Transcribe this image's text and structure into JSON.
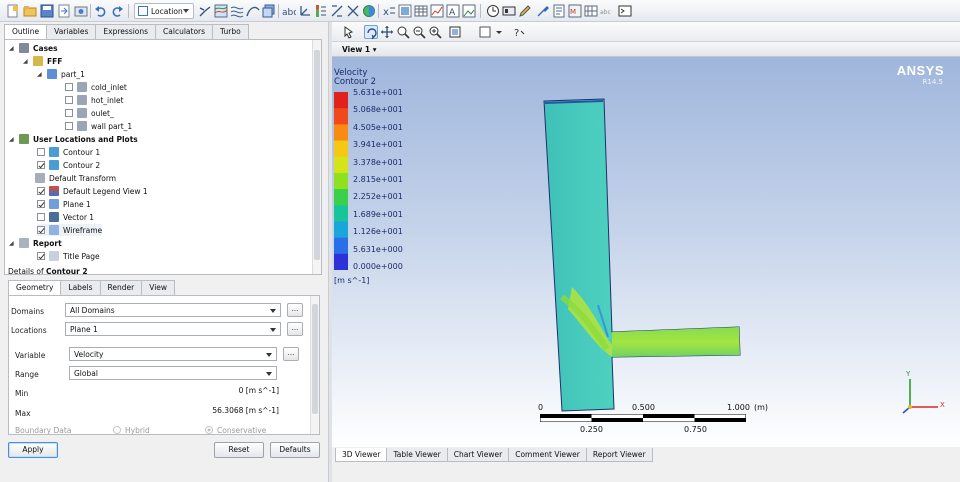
{
  "toolbar": {
    "location_label": "Location"
  },
  "outline": {
    "tabs": [
      "Outline",
      "Variables",
      "Expressions",
      "Calculators",
      "Turbo"
    ],
    "tree": [
      {
        "label": "Cases",
        "bold": true
      },
      {
        "label": "FFF",
        "bold": true
      },
      {
        "label": "part_1"
      },
      {
        "label": "cold_inlet"
      },
      {
        "label": "hot_inlet"
      },
      {
        "label": "oulet_"
      },
      {
        "label": "wall part_1"
      },
      {
        "label": "User Locations and Plots",
        "bold": true
      },
      {
        "label": "Contour 1"
      },
      {
        "label": "Contour 2"
      },
      {
        "label": "Default Transform"
      },
      {
        "label": "Default Legend View 1"
      },
      {
        "label": "Plane 1"
      },
      {
        "label": "Vector 1"
      },
      {
        "label": "Wireframe"
      },
      {
        "label": "Report",
        "bold": true
      },
      {
        "label": "Title Page"
      }
    ]
  },
  "details": {
    "prefix": "Details of",
    "object": "Contour 2",
    "tabs": [
      "Geometry",
      "Labels",
      "Render",
      "View"
    ],
    "domains_label": "Domains",
    "domains_value": "All Domains",
    "locations_label": "Locations",
    "locations_value": "Plane 1",
    "variable_label": "Variable",
    "variable_value": "Velocity",
    "range_label": "Range",
    "range_value": "Global",
    "min_label": "Min",
    "min_value": "0 [m s^-1]",
    "max_label": "Max",
    "max_value": "56.3068 [m s^-1]",
    "boundary_label": "Boundary Data",
    "hybrid_label": "Hybrid",
    "conservative_label": "Conservative",
    "ellipsis": "...",
    "apply": "Apply",
    "reset": "Reset",
    "defaults": "Defaults"
  },
  "viewer": {
    "view_label": "View 1",
    "brand": "ANSYS",
    "version": "R14.5",
    "legend": {
      "variable": "Velocity",
      "plot": "Contour 2",
      "unit": "[m s^-1]",
      "labels": [
        "5.631e+001",
        "5.068e+001",
        "4.505e+001",
        "3.941e+001",
        "3.378e+001",
        "2.815e+001",
        "2.252e+001",
        "1.689e+001",
        "1.126e+001",
        "5.631e+000",
        "0.000e+000"
      ],
      "colors": [
        "#e0221d",
        "#f04a1c",
        "#f98a14",
        "#f6c816",
        "#d5e31a",
        "#8fe01f",
        "#3bd04a",
        "#1ac49a",
        "#1aa6d8",
        "#2a6fe8",
        "#2d32d8"
      ]
    },
    "scale": {
      "labels_top": [
        "0",
        "0.500",
        "1.000",
        "(m)"
      ],
      "labels_bottom": [
        "0.250",
        "0.750"
      ]
    },
    "axis_y": "Y",
    "axis_x": "X",
    "tabs": [
      "3D Viewer",
      "Table Viewer",
      "Chart Viewer",
      "Comment Viewer",
      "Report Viewer"
    ]
  }
}
